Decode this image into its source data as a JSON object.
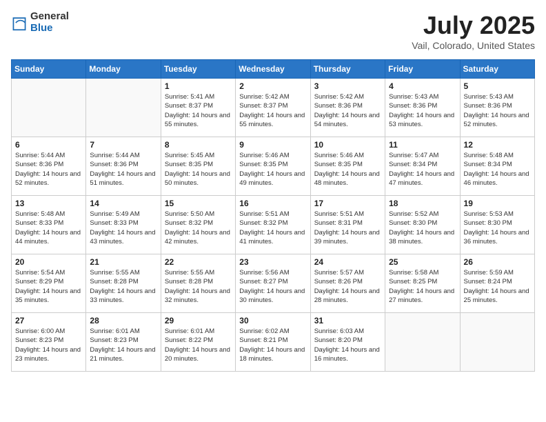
{
  "header": {
    "logo_general": "General",
    "logo_blue": "Blue",
    "month_title": "July 2025",
    "location": "Vail, Colorado, United States"
  },
  "days_of_week": [
    "Sunday",
    "Monday",
    "Tuesday",
    "Wednesday",
    "Thursday",
    "Friday",
    "Saturday"
  ],
  "weeks": [
    [
      {
        "day": "",
        "sunrise": "",
        "sunset": "",
        "daylight": ""
      },
      {
        "day": "",
        "sunrise": "",
        "sunset": "",
        "daylight": ""
      },
      {
        "day": "1",
        "sunrise": "Sunrise: 5:41 AM",
        "sunset": "Sunset: 8:37 PM",
        "daylight": "Daylight: 14 hours and 55 minutes."
      },
      {
        "day": "2",
        "sunrise": "Sunrise: 5:42 AM",
        "sunset": "Sunset: 8:37 PM",
        "daylight": "Daylight: 14 hours and 55 minutes."
      },
      {
        "day": "3",
        "sunrise": "Sunrise: 5:42 AM",
        "sunset": "Sunset: 8:36 PM",
        "daylight": "Daylight: 14 hours and 54 minutes."
      },
      {
        "day": "4",
        "sunrise": "Sunrise: 5:43 AM",
        "sunset": "Sunset: 8:36 PM",
        "daylight": "Daylight: 14 hours and 53 minutes."
      },
      {
        "day": "5",
        "sunrise": "Sunrise: 5:43 AM",
        "sunset": "Sunset: 8:36 PM",
        "daylight": "Daylight: 14 hours and 52 minutes."
      }
    ],
    [
      {
        "day": "6",
        "sunrise": "Sunrise: 5:44 AM",
        "sunset": "Sunset: 8:36 PM",
        "daylight": "Daylight: 14 hours and 52 minutes."
      },
      {
        "day": "7",
        "sunrise": "Sunrise: 5:44 AM",
        "sunset": "Sunset: 8:36 PM",
        "daylight": "Daylight: 14 hours and 51 minutes."
      },
      {
        "day": "8",
        "sunrise": "Sunrise: 5:45 AM",
        "sunset": "Sunset: 8:35 PM",
        "daylight": "Daylight: 14 hours and 50 minutes."
      },
      {
        "day": "9",
        "sunrise": "Sunrise: 5:46 AM",
        "sunset": "Sunset: 8:35 PM",
        "daylight": "Daylight: 14 hours and 49 minutes."
      },
      {
        "day": "10",
        "sunrise": "Sunrise: 5:46 AM",
        "sunset": "Sunset: 8:35 PM",
        "daylight": "Daylight: 14 hours and 48 minutes."
      },
      {
        "day": "11",
        "sunrise": "Sunrise: 5:47 AM",
        "sunset": "Sunset: 8:34 PM",
        "daylight": "Daylight: 14 hours and 47 minutes."
      },
      {
        "day": "12",
        "sunrise": "Sunrise: 5:48 AM",
        "sunset": "Sunset: 8:34 PM",
        "daylight": "Daylight: 14 hours and 46 minutes."
      }
    ],
    [
      {
        "day": "13",
        "sunrise": "Sunrise: 5:48 AM",
        "sunset": "Sunset: 8:33 PM",
        "daylight": "Daylight: 14 hours and 44 minutes."
      },
      {
        "day": "14",
        "sunrise": "Sunrise: 5:49 AM",
        "sunset": "Sunset: 8:33 PM",
        "daylight": "Daylight: 14 hours and 43 minutes."
      },
      {
        "day": "15",
        "sunrise": "Sunrise: 5:50 AM",
        "sunset": "Sunset: 8:32 PM",
        "daylight": "Daylight: 14 hours and 42 minutes."
      },
      {
        "day": "16",
        "sunrise": "Sunrise: 5:51 AM",
        "sunset": "Sunset: 8:32 PM",
        "daylight": "Daylight: 14 hours and 41 minutes."
      },
      {
        "day": "17",
        "sunrise": "Sunrise: 5:51 AM",
        "sunset": "Sunset: 8:31 PM",
        "daylight": "Daylight: 14 hours and 39 minutes."
      },
      {
        "day": "18",
        "sunrise": "Sunrise: 5:52 AM",
        "sunset": "Sunset: 8:30 PM",
        "daylight": "Daylight: 14 hours and 38 minutes."
      },
      {
        "day": "19",
        "sunrise": "Sunrise: 5:53 AM",
        "sunset": "Sunset: 8:30 PM",
        "daylight": "Daylight: 14 hours and 36 minutes."
      }
    ],
    [
      {
        "day": "20",
        "sunrise": "Sunrise: 5:54 AM",
        "sunset": "Sunset: 8:29 PM",
        "daylight": "Daylight: 14 hours and 35 minutes."
      },
      {
        "day": "21",
        "sunrise": "Sunrise: 5:55 AM",
        "sunset": "Sunset: 8:28 PM",
        "daylight": "Daylight: 14 hours and 33 minutes."
      },
      {
        "day": "22",
        "sunrise": "Sunrise: 5:55 AM",
        "sunset": "Sunset: 8:28 PM",
        "daylight": "Daylight: 14 hours and 32 minutes."
      },
      {
        "day": "23",
        "sunrise": "Sunrise: 5:56 AM",
        "sunset": "Sunset: 8:27 PM",
        "daylight": "Daylight: 14 hours and 30 minutes."
      },
      {
        "day": "24",
        "sunrise": "Sunrise: 5:57 AM",
        "sunset": "Sunset: 8:26 PM",
        "daylight": "Daylight: 14 hours and 28 minutes."
      },
      {
        "day": "25",
        "sunrise": "Sunrise: 5:58 AM",
        "sunset": "Sunset: 8:25 PM",
        "daylight": "Daylight: 14 hours and 27 minutes."
      },
      {
        "day": "26",
        "sunrise": "Sunrise: 5:59 AM",
        "sunset": "Sunset: 8:24 PM",
        "daylight": "Daylight: 14 hours and 25 minutes."
      }
    ],
    [
      {
        "day": "27",
        "sunrise": "Sunrise: 6:00 AM",
        "sunset": "Sunset: 8:23 PM",
        "daylight": "Daylight: 14 hours and 23 minutes."
      },
      {
        "day": "28",
        "sunrise": "Sunrise: 6:01 AM",
        "sunset": "Sunset: 8:23 PM",
        "daylight": "Daylight: 14 hours and 21 minutes."
      },
      {
        "day": "29",
        "sunrise": "Sunrise: 6:01 AM",
        "sunset": "Sunset: 8:22 PM",
        "daylight": "Daylight: 14 hours and 20 minutes."
      },
      {
        "day": "30",
        "sunrise": "Sunrise: 6:02 AM",
        "sunset": "Sunset: 8:21 PM",
        "daylight": "Daylight: 14 hours and 18 minutes."
      },
      {
        "day": "31",
        "sunrise": "Sunrise: 6:03 AM",
        "sunset": "Sunset: 8:20 PM",
        "daylight": "Daylight: 14 hours and 16 minutes."
      },
      {
        "day": "",
        "sunrise": "",
        "sunset": "",
        "daylight": ""
      },
      {
        "day": "",
        "sunrise": "",
        "sunset": "",
        "daylight": ""
      }
    ]
  ]
}
